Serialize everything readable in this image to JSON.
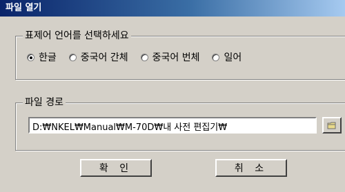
{
  "window": {
    "title": "파일 열기"
  },
  "language_group": {
    "legend": "표제어 언어를 선택하세요",
    "options": [
      {
        "label": "한글",
        "checked": true
      },
      {
        "label": "중국어 간체",
        "checked": false
      },
      {
        "label": "중국어 번체",
        "checked": false
      },
      {
        "label": "일어",
        "checked": false
      }
    ]
  },
  "path_group": {
    "legend": "파일 경로",
    "value": "D:₩NKEL₩Manual₩M-70D₩내 사전 편집기₩",
    "browse_icon": "folder-icon"
  },
  "buttons": {
    "ok": "확 인",
    "cancel": "취 소"
  }
}
